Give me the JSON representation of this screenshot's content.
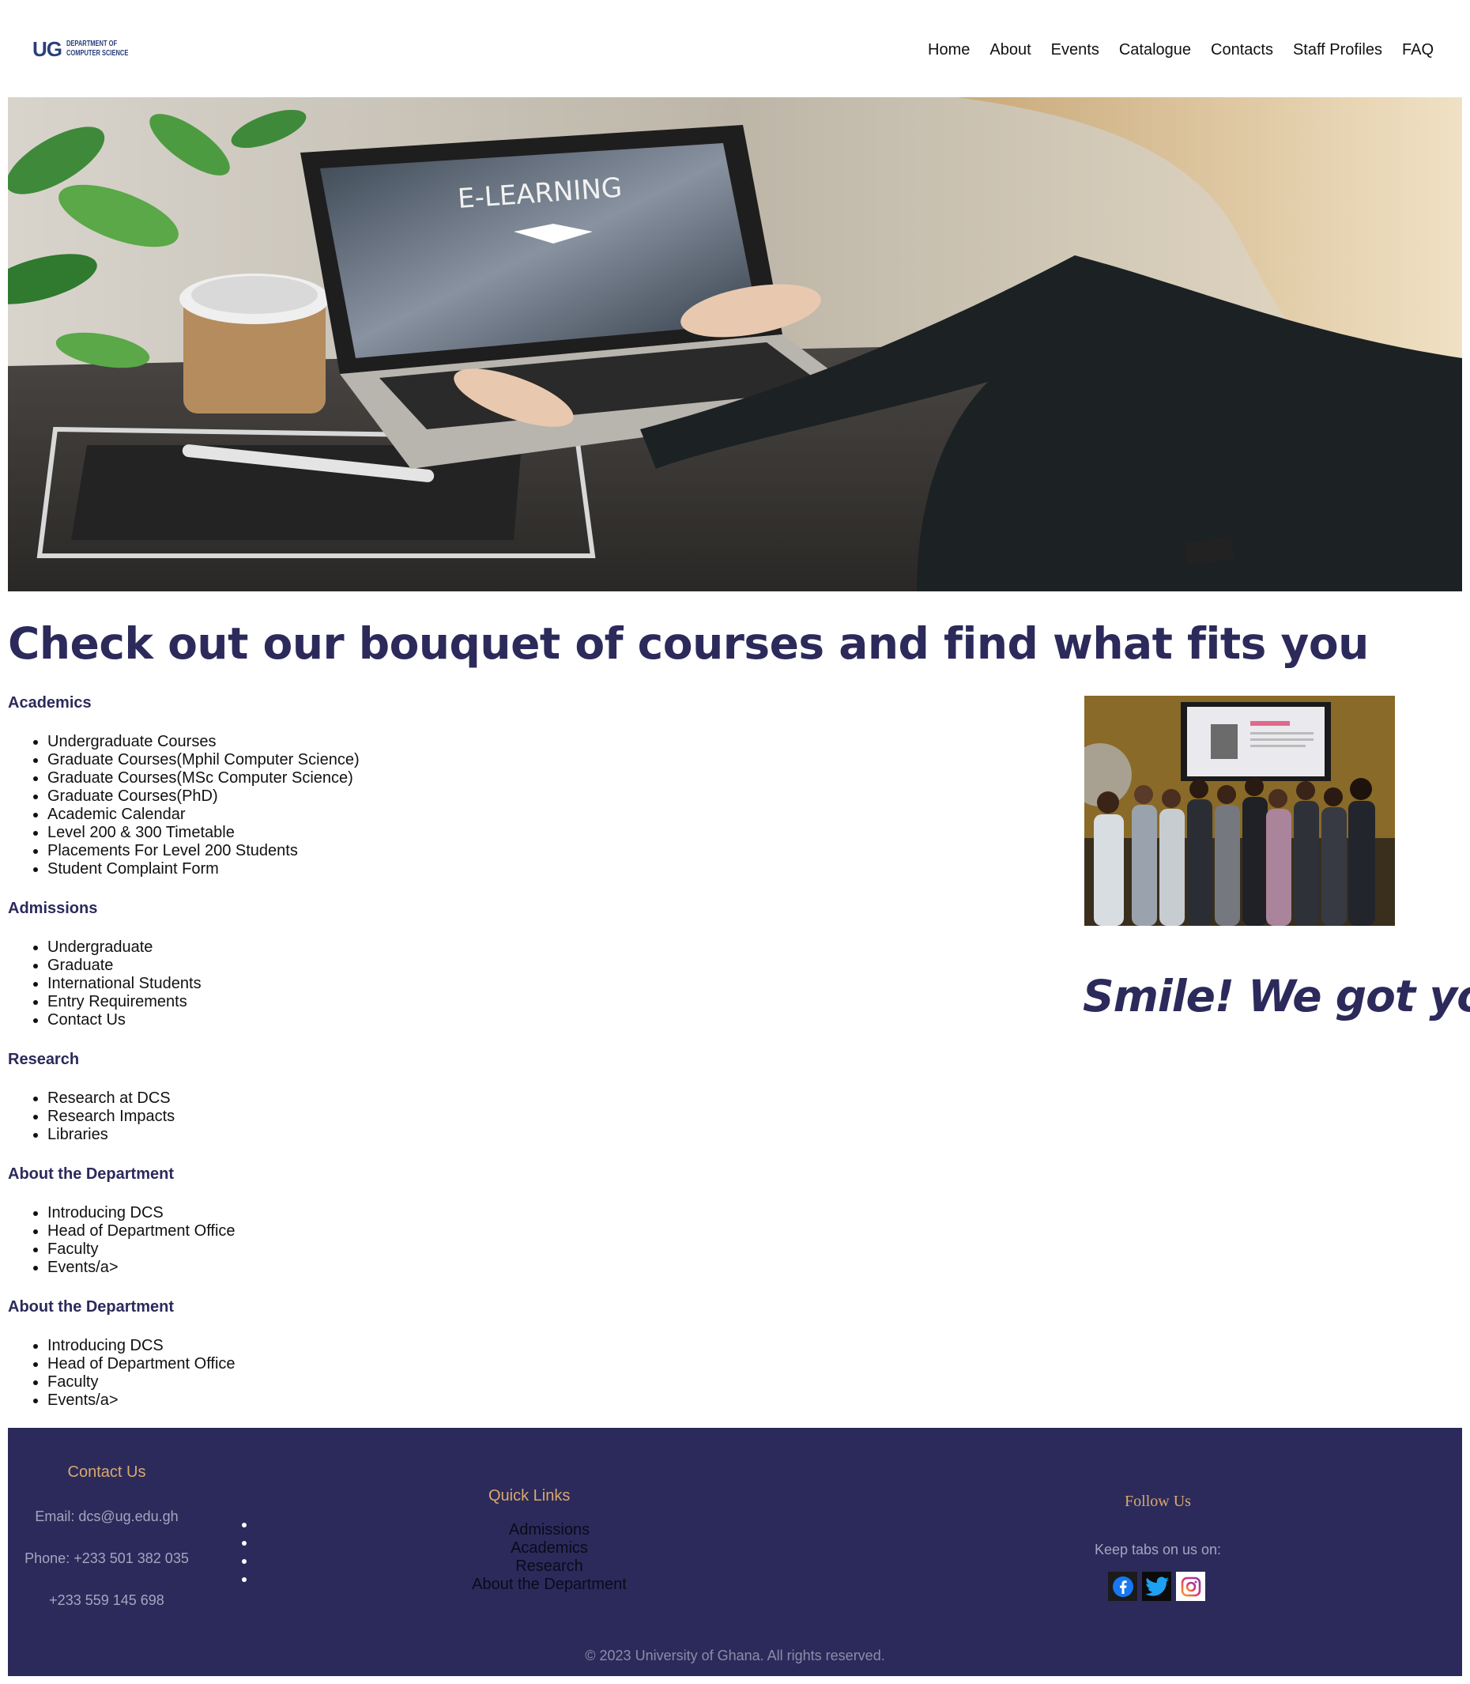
{
  "header": {
    "logo": {
      "mark": "UG",
      "dept_line1": "DEPARTMENT OF",
      "dept_line2": "COMPUTER SCIENCE"
    },
    "nav": [
      "Home",
      "About",
      "Events",
      "Catalogue",
      "Contacts",
      "Staff Profiles",
      "FAQ"
    ]
  },
  "hero": {
    "screen_text": "E-LEARNING"
  },
  "main": {
    "title": "Check out our bouquet of courses and find what fits you",
    "sections": [
      {
        "heading": "Academics",
        "items": [
          "Undergraduate Courses",
          "Graduate Courses(Mphil Computer Science)",
          "Graduate Courses(MSc Computer Science)",
          "Graduate Courses(PhD)",
          "Academic Calendar",
          "Level 200 & 300 Timetable",
          "Placements For Level 200 Students",
          "Student Complaint Form"
        ]
      },
      {
        "heading": "Admissions",
        "items": [
          "Undergraduate",
          "Graduate",
          "International Students",
          "Entry Requirements",
          "Contact Us"
        ]
      },
      {
        "heading": "Research",
        "items": [
          "Research at DCS",
          "Research Impacts",
          "Libraries"
        ]
      },
      {
        "heading": "About the Department",
        "items": [
          "Introducing DCS",
          "Head of Department Office",
          "Faculty",
          "Events/a>"
        ]
      },
      {
        "heading": "About the Department",
        "items": [
          "Introducing DCS",
          "Head of Department Office",
          "Faculty",
          "Events/a>"
        ]
      }
    ],
    "smile": "Smile! We got you"
  },
  "footer": {
    "contact": {
      "heading": "Contact Us",
      "email": "Email: dcs@ug.edu.gh",
      "phone": "Phone: +233 501 382 035",
      "phone2": "+233 559 145 698"
    },
    "quick_links": {
      "heading": "Quick Links",
      "links": [
        "Admissions",
        "Academics",
        "Research",
        "About the Department"
      ]
    },
    "follow": {
      "heading": "Follow Us",
      "sub": "Keep tabs on us on:",
      "icons": [
        "facebook-icon",
        "twitter-icon",
        "instagram-icon"
      ]
    },
    "copyright": "© 2023 University of Ghana. All rights reserved."
  },
  "colors": {
    "brand_navy": "#2c2a5b",
    "footer_heading": "#d9a86c",
    "footer_text": "#a7a4bf"
  }
}
